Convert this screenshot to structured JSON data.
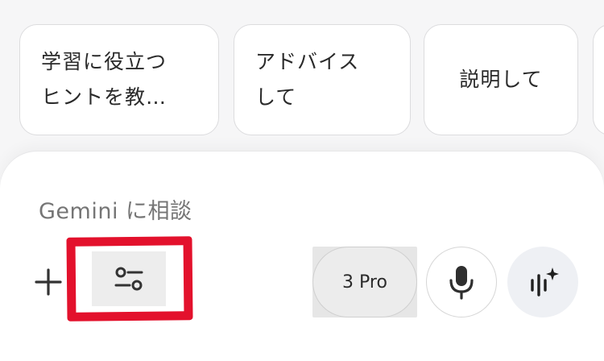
{
  "suggestions": [
    {
      "label": "学習に役立つ\nヒントを教…"
    },
    {
      "label": "アドバイス\nして"
    },
    {
      "label": "説明して"
    },
    {
      "label": ""
    }
  ],
  "input": {
    "placeholder": "Gemini に相談"
  },
  "toolbar": {
    "add_icon": "plus-icon",
    "tools_icon": "tune-icon",
    "model_label": "3 Pro",
    "mic_icon": "microphone-icon",
    "live_icon": "live-sparkle-icon"
  },
  "colors": {
    "highlight": "#e3112c",
    "panel": "#ffffff",
    "background": "#f6f6f7"
  }
}
